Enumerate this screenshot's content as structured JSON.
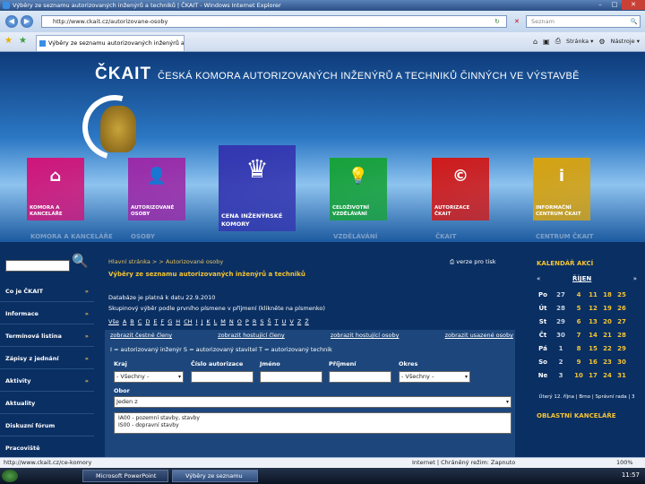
{
  "window": {
    "title": "Výběry ze seznamu autorizovaných inženýrů a techniků | ČKAIT - Windows Internet Explorer",
    "btn_min": "–",
    "btn_max": "□",
    "btn_close": "✕"
  },
  "addressbar": {
    "back": "◀",
    "forward": "▶",
    "url": "http://www.ckait.cz/autorizovane-osoby",
    "go": "↻",
    "stop": "✕",
    "search_placeholder": "Seznam",
    "search_icon": "🔍"
  },
  "tabbar": {
    "tab_label": "Výběry ze seznamu autorizovaných inženýrů a tec...",
    "commands": [
      "Stránka ▾",
      "Nástroje ▾"
    ]
  },
  "site": {
    "logo": "ČKAIT",
    "org_name": "ČESKÁ KOMORA AUTORIZOVANÝCH INŽENÝRŮ A TECHNIKŮ ČINNÝCH VE VÝSTAVBĚ",
    "tiles": [
      {
        "label": "KOMORA A KANCELÁŘE",
        "reflect": "KOMORA A KANCELÁŘE",
        "color": "#d0157a",
        "icon": "⌂"
      },
      {
        "label": "AUTORIZOVANÉ OSOBY",
        "reflect": "OSOBY",
        "color": "#9b2aa8",
        "icon": "👤"
      },
      {
        "label": "CENA INŽENÝRSKÉ KOMORY",
        "reflect": "",
        "color": "#3436b0",
        "icon": "♛"
      },
      {
        "label": "CELOŽIVOTNÍ VZDĚLÁVÁNÍ",
        "reflect": "VZDĚLÁVÁNÍ",
        "color": "#17a23a",
        "icon": "💡"
      },
      {
        "label": "AUTORIZACE ČKAIT",
        "reflect": "ČKAIT",
        "color": "#d01a1a",
        "icon": "©"
      },
      {
        "label": "INFORMAČNÍ CENTRUM ČKAIT",
        "reflect": "CENTRUM ČKAIT",
        "color": "#d6a210",
        "icon": "i"
      }
    ],
    "sidebar": {
      "search_icon": "🔍",
      "items": [
        {
          "label": "Co je ČKAIT",
          "arrow": "»"
        },
        {
          "label": "Informace",
          "arrow": "»"
        },
        {
          "label": "Termínová listina",
          "arrow": "»"
        },
        {
          "label": "Zápisy z jednání",
          "arrow": "»"
        },
        {
          "label": "Aktivity",
          "arrow": "»"
        },
        {
          "label": "Aktuality",
          "arrow": ""
        },
        {
          "label": "Diskuzní fórum",
          "arrow": ""
        },
        {
          "label": "Pracoviště",
          "arrow": ""
        }
      ]
    },
    "content": {
      "breadcrumb": "Hlavní stránka > > Autorizované osoby",
      "print": "verze pro tisk",
      "title": "Výběry ze seznamu autorizovaných inženýrů a techniků",
      "updated": "Databáze je platná k datu 22.9.2010",
      "group_hint": "Skupinový výběr podle prvního písmene v příjmení (klikněte na písmenko)",
      "letters": [
        "Vše",
        "A",
        "B",
        "C",
        "D",
        "E",
        "F",
        "G",
        "H",
        "CH",
        "I",
        "J",
        "K",
        "L",
        "M",
        "N",
        "O",
        "P",
        "R",
        "S",
        "Š",
        "T",
        "U",
        "V",
        "Z",
        "Ž"
      ],
      "links": [
        "zobrazit čestné členy",
        "zobrazit hostující členy",
        "zobrazit hostující osoby",
        "zobrazit usazené osoby"
      ],
      "legend": "I = autorizovaný inženýr    S = autorizovaný stavitel    T = autorizovaný technik",
      "fields": {
        "kraj_label": "Kraj",
        "kraj_value": "- Všechny -",
        "cislo_label": "Číslo autorizace",
        "jmeno_label": "Jméno",
        "prijmeni_label": "Příjmení",
        "okres_label": "Okres",
        "okres_value": "- Všechny -",
        "obor_label": "Obor",
        "obor_value": "Jeden z",
        "dd": "▾"
      },
      "obor_list": [
        "IA00 - pozemní stavby, stavby",
        "IS00 - dopravní stavby"
      ]
    },
    "calendar": {
      "title": "KALENDÁŘ AKCÍ",
      "prev": "«",
      "month": "ŘÍJEN",
      "next": "»",
      "rows": [
        [
          "Po",
          "27",
          "4",
          "11",
          "18",
          "25"
        ],
        [
          "Út",
          "28",
          "5",
          "12",
          "19",
          "26"
        ],
        [
          "St",
          "29",
          "6",
          "13",
          "20",
          "27"
        ],
        [
          "Čt",
          "30",
          "7",
          "14",
          "21",
          "28"
        ],
        [
          "Pá",
          "1",
          "8",
          "15",
          "22",
          "29"
        ],
        [
          "So",
          "2",
          "9",
          "16",
          "23",
          "30"
        ],
        [
          "Ne",
          "3",
          "10",
          "17",
          "24",
          "31"
        ]
      ],
      "note": "Úterý 12. října | Brno | Správní rada | 3",
      "offices_title": "OBLASTNÍ KANCELÁŘE"
    }
  },
  "statusbar": {
    "url": "http://www.ckait.cz/ce-komory",
    "zone": "Internet | Chráněný režim: Zapnuto",
    "zoom": "100%"
  },
  "taskbar": {
    "tasks": [
      "Microsoft PowerPoint",
      "Výběry ze seznamu"
    ],
    "clock": "11:57"
  }
}
